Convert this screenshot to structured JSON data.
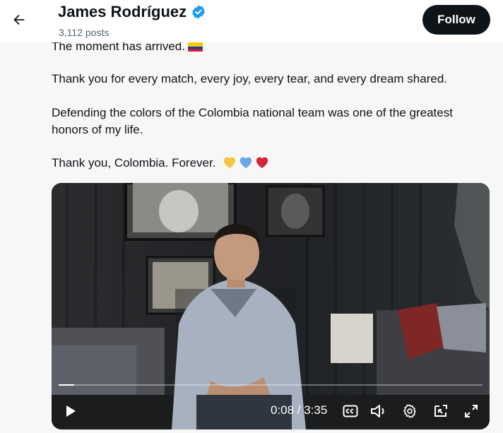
{
  "header": {
    "name": "James Rodríguez",
    "posts": "3,112 posts",
    "follow_label": "Follow"
  },
  "tweet": {
    "line1": "The moment has arrived.",
    "line2": "Thank you for every match, every joy, every tear, and every dream shared.",
    "line3": "Defending the colors of the Colombia national team was one of the greatest honors of my life.",
    "line4": "Thank you, Colombia. Forever."
  },
  "video": {
    "current_time": "0:08",
    "duration": "3:35",
    "time_display": "0:08 / 3:35",
    "progress": 0.037
  },
  "icons": {
    "back": "arrow-left-icon",
    "verified": "verified-badge-icon",
    "play": "play-icon",
    "captions": "closed-captions-icon",
    "volume": "volume-icon",
    "settings": "gear-icon",
    "popout": "pip-icon",
    "fullscreen": "fullscreen-icon"
  },
  "colors": {
    "verified": "#1d9bf0",
    "follow_bg": "#0f1419",
    "text_secondary": "#536471",
    "heart_yellow": "#f5c542",
    "heart_blue": "#6aa8e8",
    "heart_red": "#d3243c"
  }
}
